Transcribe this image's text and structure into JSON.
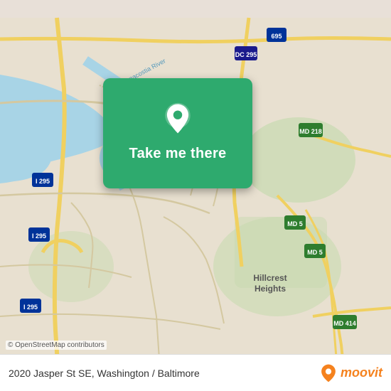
{
  "map": {
    "attribution": "© OpenStreetMap contributors"
  },
  "card": {
    "button_label": "Take me there",
    "pin_alt": "location-pin"
  },
  "bottom_bar": {
    "address": "2020 Jasper St SE, Washington / Baltimore",
    "moovit_label": "moovit"
  }
}
